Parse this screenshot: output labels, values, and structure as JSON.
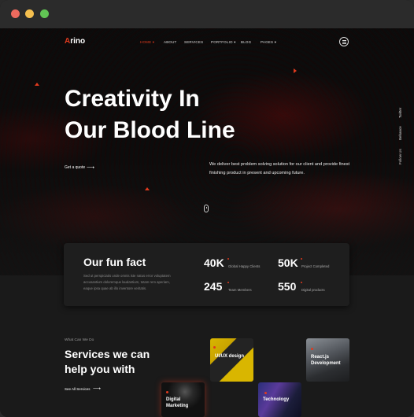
{
  "window": {
    "title_dots": [
      "close",
      "minimize",
      "maximize"
    ]
  },
  "header": {
    "logo_first": "A",
    "logo_rest": "rino",
    "nav": [
      "HOME ▾",
      "ABOUT",
      "SERVICES",
      "PORTFOLIO ▾",
      "BLOG",
      "PAGES ▾"
    ],
    "menu_icon": "hamburger-circle-icon"
  },
  "hero": {
    "title_line1": "Creativity In",
    "title_line2": "Our Blood Line",
    "description": "We deliver best problem solving solution for our client and provide finest finishing product in present and upcoming future.",
    "cta": "Get a quote",
    "cta_arrow": "⟶",
    "social": [
      "Follow Us",
      "Behance",
      "Twitter"
    ]
  },
  "funfact": {
    "title": "Our fun fact",
    "description": "Sed ut perspiciatis unde omnis iste natus error voluptatem accusantium doloremque laudantium, totam rem aperiam, eaque ipsa quae ab illo inventore veritatis.",
    "stats": [
      {
        "value": "40K",
        "label": "Global Happy Clients"
      },
      {
        "value": "50K",
        "label": "Project Completed"
      },
      {
        "value": "245",
        "label": "Team Members"
      },
      {
        "value": "550",
        "label": "Digital products"
      }
    ]
  },
  "services": {
    "kicker": "What Can We Do",
    "title": "Services we can help you with",
    "see_all": "See All Services",
    "see_all_arrow": "⟶",
    "cards": [
      {
        "label": "UI/UX design"
      },
      {
        "label": "React.js Development"
      },
      {
        "label": "Digital Marketing"
      },
      {
        "label": "Technology"
      }
    ]
  },
  "colors": {
    "accent": "#e03a1e",
    "background": "#111111"
  }
}
